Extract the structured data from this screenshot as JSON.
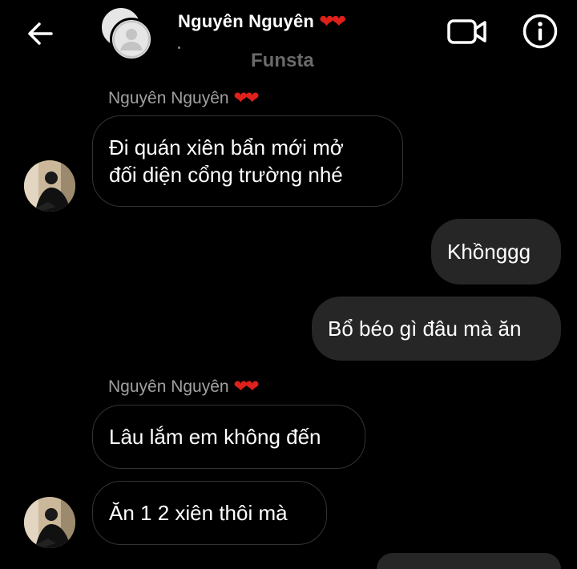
{
  "header": {
    "back_icon": "arrow-left-icon",
    "title": "Nguyên Nguyên",
    "title_hearts": "❤❤",
    "subtitle": "Funsta",
    "video_icon": "video-camera-icon",
    "info_icon": "info-icon"
  },
  "messages": [
    {
      "sender": "Nguyên Nguyên",
      "sender_hearts": "❤❤",
      "line1": "Đi quán xiên bẩn mới mở",
      "line2": "đối diện cổng trường nhé",
      "direction": "incoming"
    },
    {
      "text": "Khồnggg",
      "direction": "outgoing"
    },
    {
      "text": "Bổ béo gì đâu mà ăn",
      "direction": "outgoing"
    },
    {
      "sender": "Nguyên Nguyên",
      "sender_hearts": "❤❤",
      "text": "Lâu lắm em không đến",
      "direction": "incoming"
    },
    {
      "text": "Ăn 1 2 xiên thôi mà",
      "direction": "incoming"
    }
  ],
  "colors": {
    "background": "#000000",
    "outgoing_bubble": "#262626",
    "incoming_border": "#333333",
    "heart": "#e0201a",
    "sender_name": "#a0a0a0"
  }
}
